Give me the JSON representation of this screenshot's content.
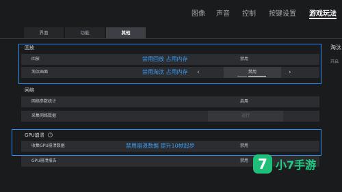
{
  "top_nav": {
    "items": [
      "图像",
      "声音",
      "控制",
      "按键设置",
      "游戏玩法"
    ],
    "active_index": 4
  },
  "sub_tabs": {
    "items": [
      "界面",
      "功能",
      "其他"
    ],
    "active_index": 2
  },
  "sections": {
    "replay": {
      "title": "回放",
      "rows": [
        {
          "label": "回放",
          "value": "禁用",
          "note": "禁用回放 占用内存"
        },
        {
          "label": "淘汰画面",
          "value": "禁用",
          "note": "禁用淘汰 占用内存",
          "prev": "‹",
          "next": "›"
        }
      ]
    },
    "network": {
      "title": "网络",
      "rows": [
        {
          "label": "网络参数统计",
          "value": "启用"
        },
        {
          "label": "采集网络数据",
          "value": "运行"
        }
      ]
    },
    "gpu": {
      "title": "GPU崩溃",
      "info_icon": "i",
      "rows": [
        {
          "label": "收集GPU崩溃数据",
          "value": "禁用",
          "note": "禁用崩溃数据 提升10帧起步"
        },
        {
          "label": "GPU崩溃报告",
          "value": "禁用"
        }
      ]
    }
  },
  "right_panel": {
    "title": "淘汰",
    "text": "开启"
  },
  "watermark": {
    "mark": "7",
    "text": "小7手游"
  },
  "colors": {
    "accent_blue": "#3b9cf5",
    "highlight_border": "#2f8cf0",
    "logo_green": "#1fbf7a",
    "background": "#1a1b1d"
  }
}
